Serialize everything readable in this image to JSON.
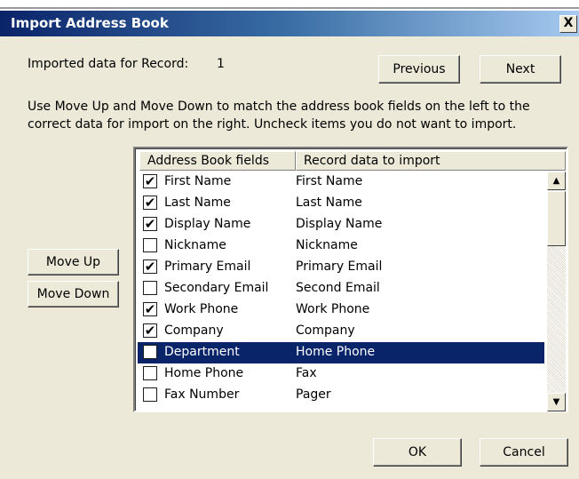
{
  "dialog": {
    "title": "Import Address Book",
    "close_label": "X",
    "record_label": "Imported data for Record:",
    "record_number": "1",
    "previous_label": "Previous",
    "next_label": "Next",
    "instructions_line1": "Use Move Up and Move Down to match the address book fields on the left to the",
    "instructions_line2": "correct data for import on the right. Uncheck items you do not want to import.",
    "move_up_label": "Move Up",
    "move_down_label": "Move Down",
    "ok_label": "OK",
    "cancel_label": "Cancel"
  },
  "list": {
    "columns": [
      "Address Book fields",
      "Record data to import"
    ],
    "rows": [
      {
        "field": "First Name",
        "data": "First Name",
        "checked": true,
        "selected": false
      },
      {
        "field": "Last Name",
        "data": "Last Name",
        "checked": true,
        "selected": false
      },
      {
        "field": "Display Name",
        "data": "Display Name",
        "checked": true,
        "selected": false
      },
      {
        "field": "Nickname",
        "data": "Nickname",
        "checked": false,
        "selected": false
      },
      {
        "field": "Primary Email",
        "data": "Primary Email",
        "checked": true,
        "selected": false
      },
      {
        "field": "Secondary Email",
        "data": "Second Email",
        "checked": false,
        "selected": false
      },
      {
        "field": "Work Phone",
        "data": "Work Phone",
        "checked": true,
        "selected": false
      },
      {
        "field": "Company",
        "data": "Company",
        "checked": true,
        "selected": false
      },
      {
        "field": "Department",
        "data": "Home Phone",
        "checked": false,
        "selected": true
      },
      {
        "field": "Home Phone",
        "data": "Fax",
        "checked": false,
        "selected": false
      },
      {
        "field": "Fax Number",
        "data": "Pager",
        "checked": false,
        "selected": false
      }
    ]
  },
  "icons": {
    "check": "✔",
    "scroll_up": "▲",
    "scroll_down": "▼"
  }
}
